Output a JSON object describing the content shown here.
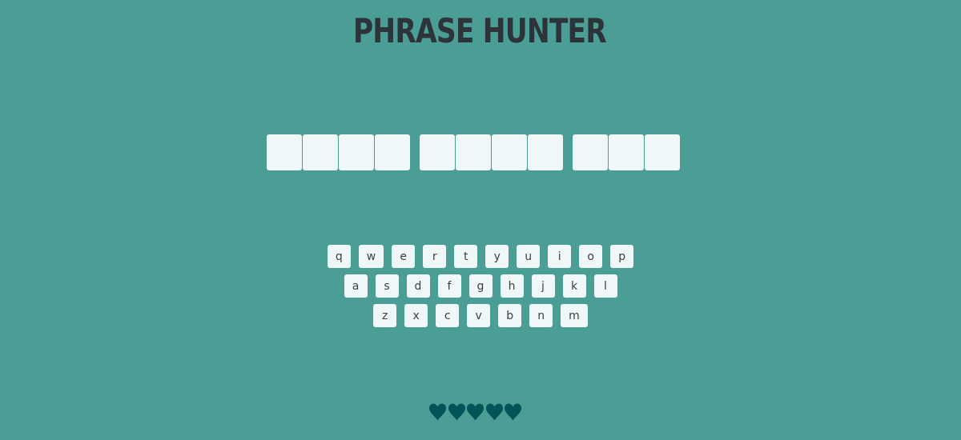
{
  "title": "PHRASE HUNTER",
  "phrase": {
    "words": [
      4,
      4,
      3
    ]
  },
  "keyboard": {
    "rows": [
      [
        "q",
        "w",
        "e",
        "r",
        "t",
        "y",
        "u",
        "i",
        "o",
        "p"
      ],
      [
        "a",
        "s",
        "d",
        "f",
        "g",
        "h",
        "j",
        "k",
        "l"
      ],
      [
        "z",
        "x",
        "c",
        "v",
        "b",
        "n",
        "m"
      ]
    ]
  },
  "lives": {
    "remaining": 5,
    "icon": "heart-icon",
    "color": "#005357"
  },
  "colors": {
    "background": "#4a9e95",
    "tile": "#eff7f8",
    "title": "#2c3339"
  }
}
